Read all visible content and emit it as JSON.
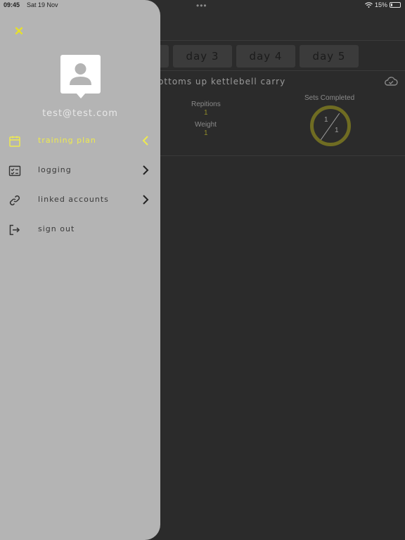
{
  "status_bar": {
    "time": "09:45",
    "date": "Sat 19 Nov",
    "dots": "•••",
    "battery": "15%"
  },
  "day_tabs": [
    {
      "label": ""
    },
    {
      "label": "Day 3"
    },
    {
      "label": "Day 4"
    },
    {
      "label": "Day 5"
    }
  ],
  "exercise": {
    "title": "RT BOTTOMS UP KETTLEBELL CARRY",
    "repetitions_label": "Repitions",
    "repetitions_value": "1",
    "weight_label": "Weight",
    "weight_value": "1",
    "sets_label": "Sets Completed",
    "sets_done": "1",
    "sets_total": "1",
    "cloud_icon": "cloud-check-icon"
  },
  "drawer": {
    "close_icon": "close-icon",
    "email": "TEST@TEST.COM",
    "items": [
      {
        "label": "Training Plan",
        "icon": "calendar-icon",
        "chevron": "chevron-left-icon",
        "active": true
      },
      {
        "label": "Logging",
        "icon": "checklist-icon",
        "chevron": "chevron-right-icon",
        "active": false
      },
      {
        "label": "Linked Accounts",
        "icon": "link-icon",
        "chevron": "chevron-right-icon",
        "active": false
      },
      {
        "label": "Sign Out",
        "icon": "sign-out-icon",
        "active": false
      }
    ]
  },
  "colors": {
    "accent": "#eeea4e",
    "drawer_bg": "#b4b4b4",
    "app_bg": "#2b2b2b"
  }
}
